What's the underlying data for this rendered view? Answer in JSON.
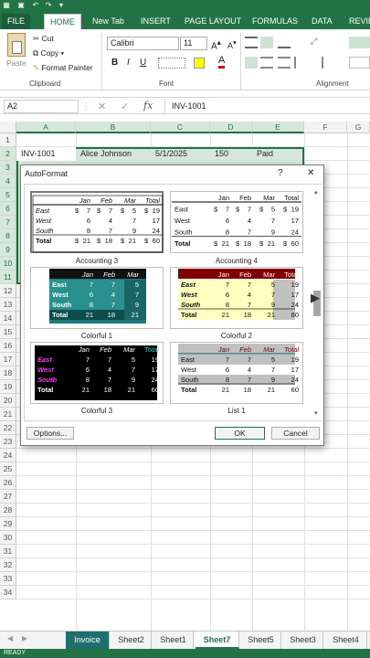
{
  "ribbon": {
    "tabs": [
      "FILE",
      "HOME",
      "New Tab",
      "INSERT",
      "PAGE LAYOUT",
      "FORMULAS",
      "DATA",
      "REVIEW"
    ],
    "active_tab": "HOME",
    "clipboard": {
      "paste": "Paste",
      "cut": "Cut",
      "copy": "Copy",
      "copy_arrow": "▾",
      "format_painter": "Format Painter",
      "label": "Clipboard"
    },
    "font": {
      "name": "Calibri",
      "size": "11",
      "bold": "B",
      "italic": "I",
      "underline": "U",
      "label": "Font"
    },
    "alignment": {
      "label": "Alignment"
    }
  },
  "formula_bar": {
    "name_box": "A2",
    "cancel": "✕",
    "enter": "✓",
    "fx": "fx",
    "value": "INV-1001"
  },
  "grid": {
    "columns": [
      "A",
      "B",
      "C",
      "D",
      "E",
      "F",
      "G"
    ],
    "rows": [
      "1",
      "2",
      "3",
      "4",
      "5",
      "6",
      "7",
      "8",
      "9",
      "10",
      "11",
      "12",
      "13",
      "14",
      "15",
      "16",
      "17",
      "18",
      "19",
      "20",
      "21",
      "22",
      "23",
      "24",
      "25",
      "26",
      "27",
      "28",
      "29",
      "30",
      "31",
      "32",
      "33",
      "34"
    ],
    "row2": {
      "a": "INV-1001",
      "b": "Alice Johnson",
      "c": "5/1/2025",
      "d": "150",
      "e": "Paid"
    }
  },
  "dialog": {
    "title": "AutoFormat",
    "help": "?",
    "close": "✕",
    "formats": [
      {
        "name": "Accounting 3"
      },
      {
        "name": "Accounting 4"
      },
      {
        "name": "Colorful 1"
      },
      {
        "name": "Colorful 2"
      },
      {
        "name": "Colorful 3"
      },
      {
        "name": "List 1"
      }
    ],
    "preview": {
      "headers": [
        "Jan",
        "Feb",
        "Mar",
        "Total"
      ],
      "rows": [
        {
          "label": "East",
          "values": [
            "7",
            "7",
            "5",
            "19"
          ]
        },
        {
          "label": "West",
          "values": [
            "6",
            "4",
            "7",
            "17"
          ]
        },
        {
          "label": "South",
          "values": [
            "8",
            "7",
            "9",
            "24"
          ]
        },
        {
          "label": "Total",
          "values": [
            "21",
            "18",
            "21",
            "60"
          ]
        }
      ],
      "currency": "$"
    },
    "options_button": "Options...",
    "ok_button": "OK",
    "cancel_button": "Cancel"
  },
  "sheet_tabs": [
    "Invoice",
    "Sheet2",
    "Sheet1",
    "Sheet7",
    "Sheet5",
    "Sheet3",
    "Sheet4"
  ],
  "active_sheet": "Sheet7",
  "sheet_nav": {
    "prev": "◀",
    "next": "▶"
  },
  "status": "READY",
  "colors": {
    "excel_green": "#217346",
    "teal_tab": "#1f6f6f",
    "colorful1_bg": "#1e7b7b",
    "colorful2_head": "#800000",
    "list1_head": "#c0c0c0"
  }
}
